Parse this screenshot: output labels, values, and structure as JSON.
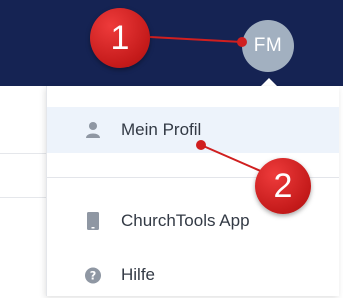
{
  "header": {
    "avatar_initials": "FM",
    "background_color": "#152353"
  },
  "menu": {
    "items": [
      {
        "label": "Mein Profil",
        "icon": "user-icon"
      },
      {
        "label": "ChurchTools App",
        "icon": "smartphone-icon"
      },
      {
        "label": "Hilfe",
        "icon": "help-circle-icon"
      }
    ]
  },
  "annotations": {
    "marker_1": "1",
    "marker_2": "2",
    "accent_color": "#d01f1f"
  }
}
